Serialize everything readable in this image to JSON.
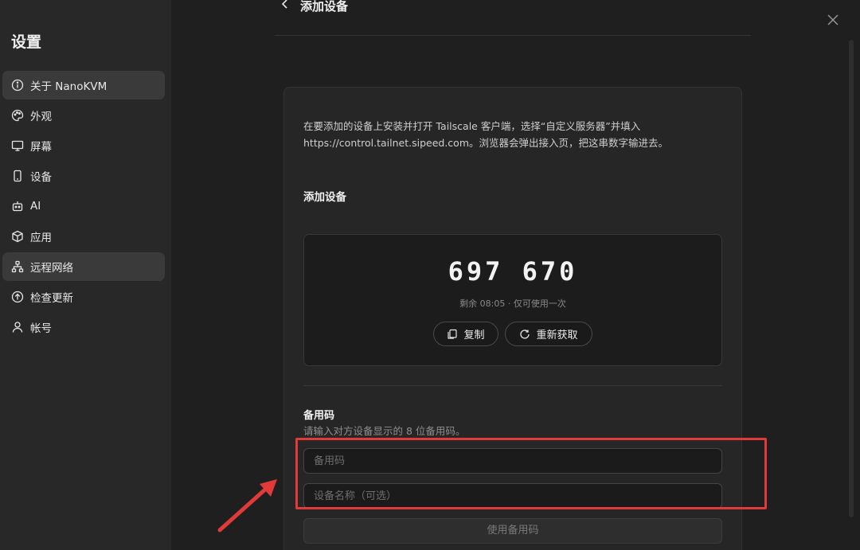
{
  "sidebar": {
    "title": "设置",
    "items": [
      {
        "label": "关于 NanoKVM",
        "icon": "info-icon",
        "active": true
      },
      {
        "label": "外观",
        "icon": "palette-icon",
        "active": false
      },
      {
        "label": "屏幕",
        "icon": "monitor-icon",
        "active": false
      },
      {
        "label": "设备",
        "icon": "device-icon",
        "active": false
      },
      {
        "label": "AI",
        "icon": "bot-icon",
        "active": false
      },
      {
        "label": "应用",
        "icon": "package-icon",
        "active": false
      },
      {
        "label": "远程网络",
        "icon": "network-icon",
        "active": true
      },
      {
        "label": "检查更新",
        "icon": "update-icon",
        "active": false
      },
      {
        "label": "帐号",
        "icon": "user-icon",
        "active": false
      }
    ]
  },
  "header": {
    "title": "添加设备"
  },
  "card": {
    "intro": "在要添加的设备上安装并打开 Tailscale 客户端，选择“自定义服务器”并填入 https://control.tailnet.sipeed.com。浏览器会弹出接入页，把这串数字输进去。",
    "section_title": "添加设备",
    "code": "697 670",
    "code_meta": "剩余 08:05 · 仅可使用一次",
    "copy_label": "复制",
    "refresh_label": "重新获取"
  },
  "backup": {
    "title": "备用码",
    "hint": "请输入对方设备显示的 8 位备用码。",
    "code_placeholder": "备用码",
    "name_placeholder": "设备名称（可选）",
    "submit_label": "使用备用码"
  },
  "colors": {
    "annotation": "#e03a3a",
    "background": "#1f1f1f",
    "sidebar": "#282828"
  }
}
